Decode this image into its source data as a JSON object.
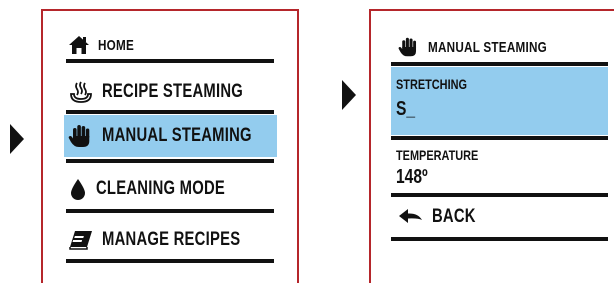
{
  "main_menu": {
    "items": [
      {
        "label": "HOME",
        "icon": "home-icon"
      },
      {
        "label": "RECIPE STEAMING",
        "icon": "steam-icon"
      },
      {
        "label": "MANUAL STEAMING",
        "icon": "hand-icon",
        "selected": true
      },
      {
        "label": "CLEANING MODE",
        "icon": "drop-icon"
      },
      {
        "label": "MANAGE RECIPES",
        "icon": "book-icon"
      }
    ]
  },
  "sub_menu": {
    "header": {
      "label": "MANUAL STEAMING",
      "icon": "hand-icon"
    },
    "stretching": {
      "label": "STRETCHING",
      "value": "S_"
    },
    "temperature": {
      "label": "TEMPERATURE",
      "value": "148º"
    },
    "back": {
      "label": "BACK",
      "icon": "back-arrow-icon"
    }
  },
  "colors": {
    "panel_border": "#b5262b",
    "selection": "#93ccee",
    "text": "#111111"
  }
}
